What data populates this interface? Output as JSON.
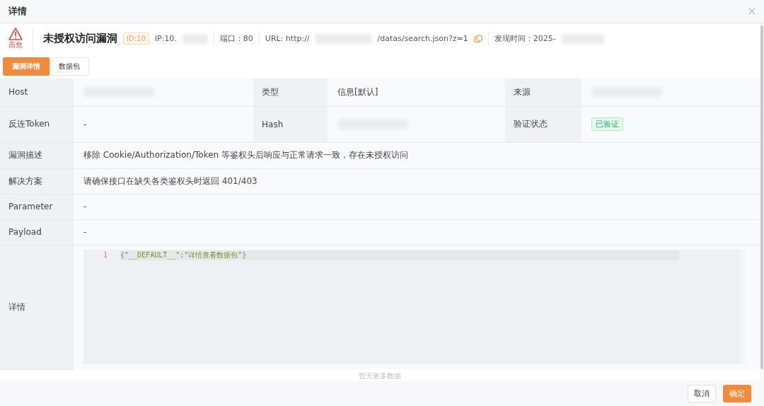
{
  "dialog": {
    "title": "详情"
  },
  "header": {
    "severity": "高危",
    "title": "未授权访问漏洞",
    "id_badge": "ID:10",
    "ip": "IP:10.",
    "port": "端口：80",
    "url_prefix": "URL: http://",
    "url_suffix": "/datas/search.json?z=1",
    "found_time": "发现时间：2025-"
  },
  "tabs": [
    {
      "label": "漏洞详情",
      "selected": true
    },
    {
      "label": "数据包",
      "selected": false
    }
  ],
  "grid_rows": [
    {
      "cells": [
        {
          "label": "Host",
          "kind": "redacted"
        },
        {
          "label": "类型",
          "value": "信息[默认]",
          "kind": "text"
        },
        {
          "label": "来源",
          "kind": "redacted"
        }
      ]
    },
    {
      "cells": [
        {
          "label": "反连Token",
          "value": "-",
          "kind": "text"
        },
        {
          "label": "Hash",
          "kind": "redacted"
        },
        {
          "label": "验证状态",
          "value": "已验证",
          "kind": "tag"
        }
      ]
    }
  ],
  "rows": [
    {
      "label": "漏洞描述",
      "value": "移除 Cookie/Authorization/Token 等鉴权头后响应与正常请求一致，存在未授权访问"
    },
    {
      "label": "解决方案",
      "value": "请确保接口在缺失各类鉴权头时返回 401/403"
    },
    {
      "label": "Parameter",
      "value": "-"
    },
    {
      "label": "Payload",
      "value": "-"
    }
  ],
  "detail": {
    "label": "详情",
    "lines": [
      {
        "number": "1",
        "code": "{\"__DEFAULT__\":\"详情查看数据包\"}"
      }
    ]
  },
  "no_more": "暂无更多数据",
  "buttons": [
    {
      "label": "取消",
      "kind": "secondary"
    },
    {
      "label": "确定",
      "kind": "primary"
    }
  ]
}
